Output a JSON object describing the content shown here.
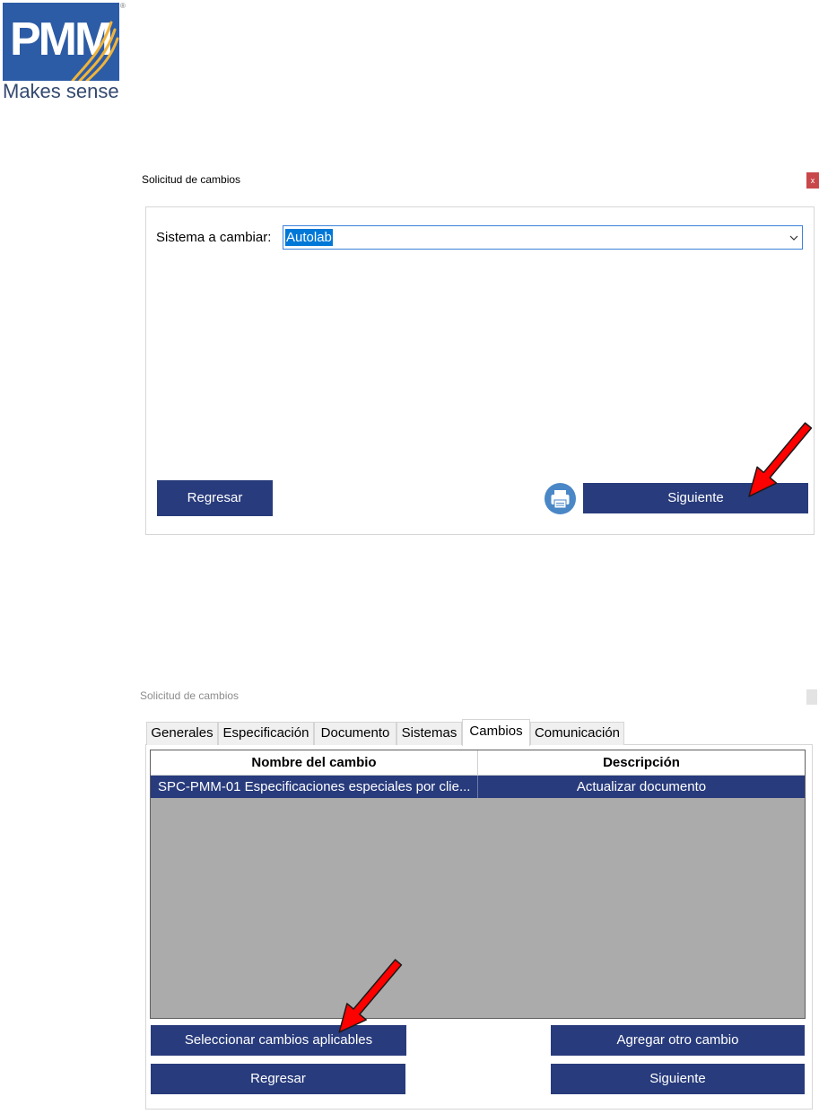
{
  "logo": {
    "name": "PMM",
    "tagline": "Makes sense",
    "mark": "®"
  },
  "dialog_sistema": {
    "title": "Solicitud de cambios",
    "close_label": "x",
    "field_label": "Sistema a cambiar:",
    "field_value": "Autolab",
    "back_label": "Regresar",
    "next_label": "Siguiente"
  },
  "dialog_cambios": {
    "title": "Solicitud de cambios",
    "tabs": [
      "Generales",
      "Especificación",
      "Documento",
      "Sistemas",
      "Cambios",
      "Comunicación"
    ],
    "active_tab_index": 4,
    "table": {
      "columns": [
        "Nombre del cambio",
        "Descripción"
      ],
      "rows": [
        {
          "nombre": "SPC-PMM-01 Especificaciones especiales por clie...",
          "descripcion": "Actualizar documento",
          "selected": true
        }
      ]
    },
    "select_changes_label": "Seleccionar cambios aplicables",
    "add_change_label": "Agregar otro cambio",
    "back_label": "Regresar",
    "next_label": "Siguiente"
  },
  "icons": {
    "print": "printer-icon",
    "dropdown": "chevron-down-icon",
    "annotation": "red-arrow-icon",
    "close": "close-icon"
  },
  "colors": {
    "button": "#283B7C",
    "selection": "#0078D7",
    "grid_background": "#ABABAB",
    "close_active": "#C8474B",
    "logo_blue": "#2D5CA6",
    "logo_gold": "#F0B43A",
    "arrow": "#FF0000",
    "print_icon": "#4A87C6"
  }
}
